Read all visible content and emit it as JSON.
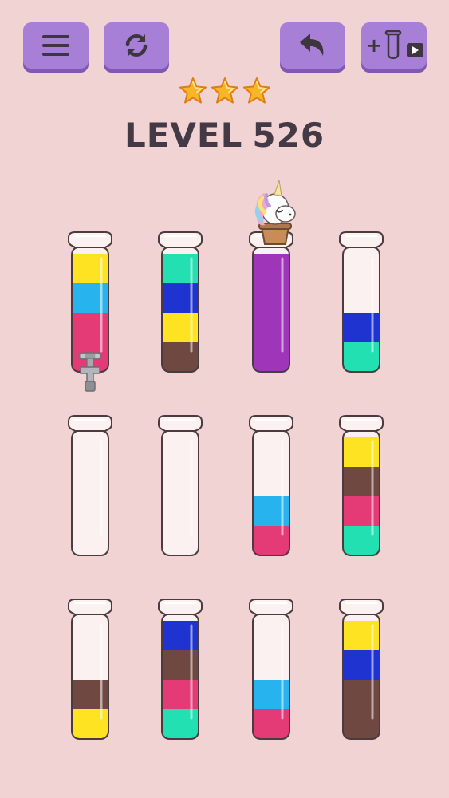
{
  "header": {
    "menu_button": {
      "icon": "hamburger-menu-icon"
    },
    "restart_button": {
      "icon": "restart-arrows-icon"
    },
    "undo_button": {
      "icon": "undo-arrow-icon"
    },
    "add_tube_button": {
      "plus_label": "+",
      "icon": "empty-tube-icon",
      "video_icon": "video-ad-icon"
    }
  },
  "rating": {
    "stars_earned": 3,
    "stars_total": 3
  },
  "level": {
    "label": "LEVEL",
    "number": "526"
  },
  "colors": {
    "yellow": "#fde322",
    "light_blue": "#27b4ee",
    "pink": "#e43a76",
    "teal": "#22e0b1",
    "blue": "#1e33cf",
    "brown": "#6e4841",
    "purple": "#9f36b9",
    "glass": "#fbf1f1",
    "outline": "#4b3b3e",
    "button": "#a77fd6",
    "background": "#f2d3d3"
  },
  "tubes": [
    {
      "id": 1,
      "segments": [
        "yellow",
        "light_blue",
        "pink",
        "pink"
      ],
      "accessory": "faucet"
    },
    {
      "id": 2,
      "segments": [
        "teal",
        "blue",
        "yellow",
        "brown"
      ]
    },
    {
      "id": 3,
      "segments": [
        "purple",
        "purple",
        "purple",
        "purple"
      ],
      "accessory": "unicorn-cup",
      "completed": true
    },
    {
      "id": 4,
      "segments": [
        "blue",
        "teal"
      ]
    },
    {
      "id": 5,
      "segments": []
    },
    {
      "id": 6,
      "segments": []
    },
    {
      "id": 7,
      "segments": [
        "light_blue",
        "pink"
      ]
    },
    {
      "id": 8,
      "segments": [
        "yellow",
        "brown",
        "pink",
        "teal"
      ]
    },
    {
      "id": 9,
      "segments": [
        "brown",
        "yellow"
      ]
    },
    {
      "id": 10,
      "segments": [
        "blue",
        "brown",
        "pink",
        "teal"
      ]
    },
    {
      "id": 11,
      "segments": [
        "light_blue",
        "pink"
      ]
    },
    {
      "id": 12,
      "segments": [
        "yellow",
        "blue",
        "brown",
        "brown"
      ]
    }
  ]
}
